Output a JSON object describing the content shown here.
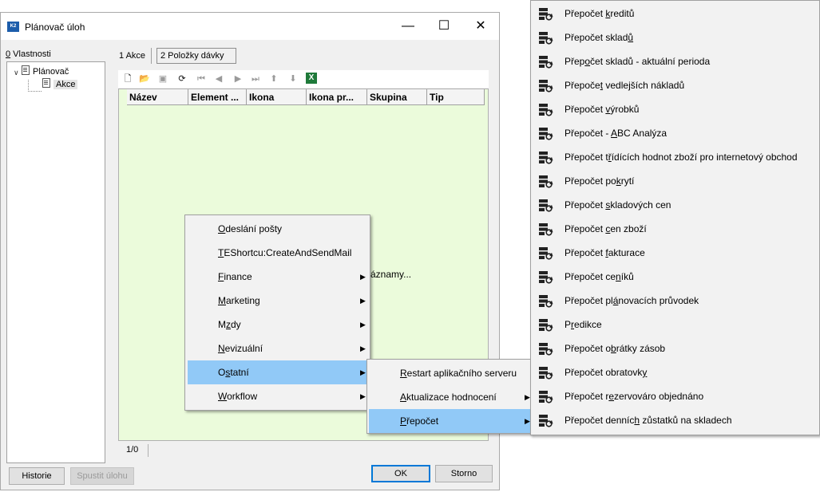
{
  "window": {
    "title": "Plánovač úloh",
    "app_icon_text": "K2",
    "minimize": "—",
    "maximize": "☐",
    "close": "✕"
  },
  "tree": {
    "label_accel": "0",
    "label_rest": " Vlastnosti",
    "root": "Plánovač",
    "child": "Akce"
  },
  "tabs": [
    "1 Akce",
    "2 Položky dávky"
  ],
  "grid": {
    "columns": [
      "Název",
      "Element ...",
      "Ikona",
      "Ikona pr...",
      "Skupina",
      "Tip"
    ],
    "empty_text": "áznamy..."
  },
  "status": {
    "position": "1/0"
  },
  "buttons": {
    "history": "Historie",
    "run": "Spustit úlohu",
    "ok": "OK",
    "cancel": "Storno"
  },
  "menu_main": [
    {
      "pre": "",
      "acc": "O",
      "post": "deslání pošty",
      "submenu": false
    },
    {
      "pre": "",
      "acc": "T",
      "post": "EShortcu:CreateAndSendMail",
      "submenu": false
    },
    {
      "pre": "",
      "acc": "F",
      "post": "inance",
      "submenu": true
    },
    {
      "pre": "",
      "acc": "M",
      "post": "arketing",
      "submenu": true
    },
    {
      "pre": "M",
      "acc": "z",
      "post": "dy",
      "submenu": true
    },
    {
      "pre": "",
      "acc": "N",
      "post": "evizuální",
      "submenu": true
    },
    {
      "pre": "O",
      "acc": "s",
      "post": "tatní",
      "submenu": true,
      "highlight": true
    },
    {
      "pre": "",
      "acc": "W",
      "post": "orkflow",
      "submenu": true
    }
  ],
  "menu_ostatni": [
    {
      "pre": "",
      "acc": "R",
      "post": "estart aplikačního serveru",
      "submenu": false
    },
    {
      "pre": "",
      "acc": "A",
      "post": "ktualizace hodnocení",
      "submenu": true
    },
    {
      "pre": "",
      "acc": "P",
      "post": "řepočet",
      "submenu": true,
      "highlight": true
    }
  ],
  "menu_prepocet": [
    {
      "pre": "Přepočet ",
      "acc": "k",
      "post": "reditů"
    },
    {
      "pre": "Přepočet sklad",
      "acc": "ů",
      "post": ""
    },
    {
      "pre": "Přep",
      "acc": "o",
      "post": "čet skladů - aktuální perioda"
    },
    {
      "pre": "Přepoče",
      "acc": "t",
      "post": " vedlejších nákladů"
    },
    {
      "pre": "Přepočet ",
      "acc": "v",
      "post": "ýrobků"
    },
    {
      "pre": "Přepočet - ",
      "acc": "A",
      "post": "BC Analýza"
    },
    {
      "pre": "Přepočet t",
      "acc": "ř",
      "post": "ídících hodnot zboží pro internetový obchod"
    },
    {
      "pre": "Přepočet po",
      "acc": "k",
      "post": "rytí"
    },
    {
      "pre": "Přepočet ",
      "acc": "s",
      "post": "kladových cen"
    },
    {
      "pre": "Přepočet ",
      "acc": "c",
      "post": "en zboží"
    },
    {
      "pre": "Přepočet ",
      "acc": "f",
      "post": "akturace"
    },
    {
      "pre": "Přepočet ce",
      "acc": "n",
      "post": "íků"
    },
    {
      "pre": "Přepočet pl",
      "acc": "á",
      "post": "novacích průvodek"
    },
    {
      "pre": "P",
      "acc": "r",
      "post": "edikce"
    },
    {
      "pre": "Přepočet o",
      "acc": "b",
      "post": "rátky zásob"
    },
    {
      "pre": "Přepočet obratovk",
      "acc": "y",
      "post": ""
    },
    {
      "pre": "Přepočet r",
      "acc": "e",
      "post": "zervováro objednáno"
    },
    {
      "pre": "Přepočet denníc",
      "acc": "h",
      "post": " zůstatků na skladech"
    }
  ]
}
